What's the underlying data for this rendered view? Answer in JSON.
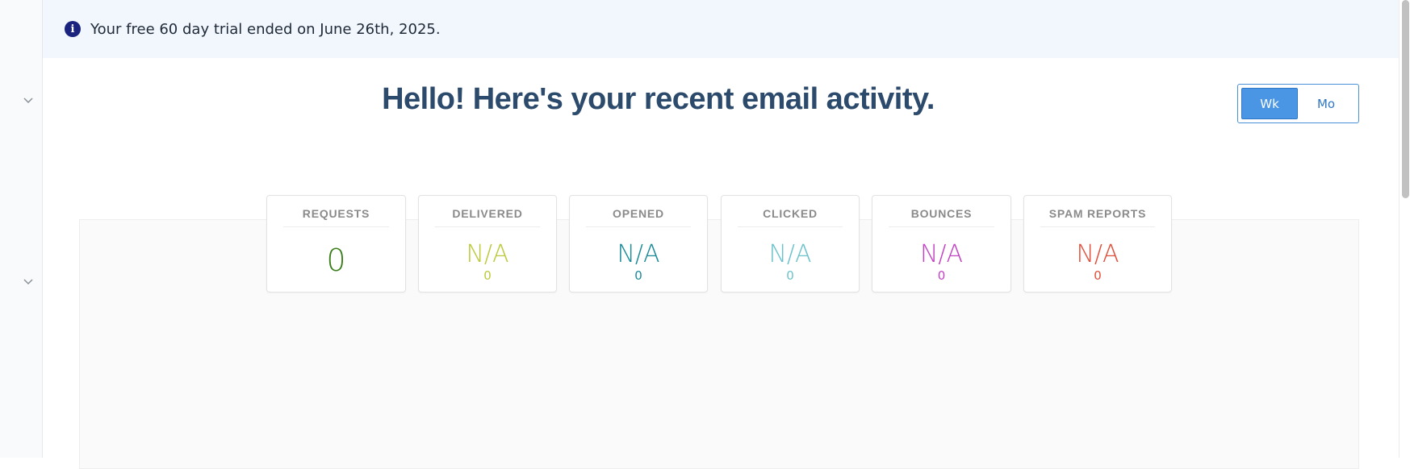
{
  "banner": {
    "icon": "info-icon",
    "icon_glyph": "i",
    "text": "Your free 60 day trial ended on June 26th, 2025."
  },
  "left_rail": {
    "chevrons": [
      "chevron-down-icon",
      "chevron-down-icon"
    ]
  },
  "main": {
    "headline": "Hello! Here's your recent email activity.",
    "period_toggle": {
      "options": [
        "Wk",
        "Mo"
      ],
      "selected": "Wk"
    }
  },
  "stats": [
    {
      "label": "REQUESTS",
      "value": "0",
      "count": "",
      "color": "#3a7d1a"
    },
    {
      "label": "DELIVERED",
      "value": "N/A",
      "count": "0",
      "color": "#bcc93b"
    },
    {
      "label": "OPENED",
      "value": "N/A",
      "count": "0",
      "color": "#1a8a99"
    },
    {
      "label": "CLICKED",
      "value": "N/A",
      "count": "0",
      "color": "#6cc2cc"
    },
    {
      "label": "BOUNCES",
      "value": "N/A",
      "count": "0",
      "color": "#c244c4"
    },
    {
      "label": "SPAM REPORTS",
      "value": "N/A",
      "count": "0",
      "color": "#e04f3a"
    }
  ],
  "colors": {
    "accent": "#4a95e4",
    "headline": "#2c4a6b",
    "banner_bg": "#f1f7fd"
  }
}
